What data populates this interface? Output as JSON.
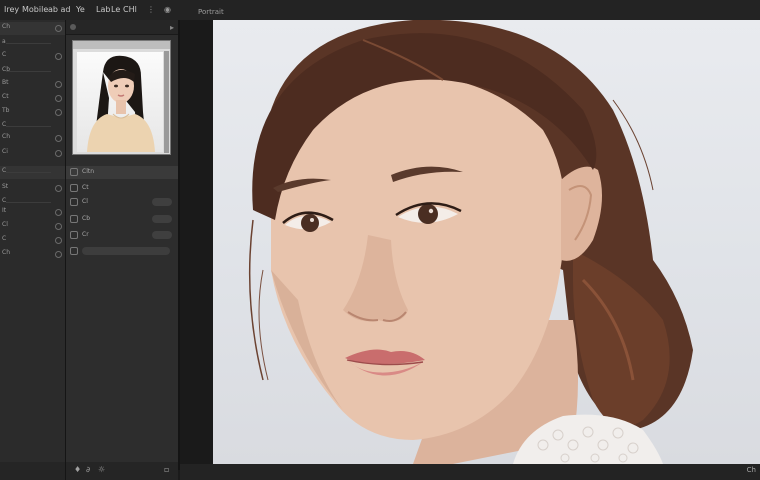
{
  "menubar": {
    "items": [
      "Irey",
      "Mobile",
      "ab ad",
      "Ye",
      "Lab",
      "Le",
      "CHl"
    ],
    "document_title": "Portrait"
  },
  "left_panel": {
    "rows": [
      "Ch",
      "a",
      "C",
      "Cb",
      "Bt",
      "Ct",
      "Tb",
      "C",
      "Ch",
      "Ci",
      "C",
      "St",
      "C",
      "It",
      "Cl",
      "C",
      "Ch"
    ]
  },
  "middle_panel": {
    "rows": [
      "Cltn",
      "Ct",
      "Cl",
      "Cb",
      "Cr",
      ""
    ]
  },
  "status": {
    "text": "Ch"
  },
  "colors": {
    "panel": "#2b2b2b",
    "canvas": "#1e1e1e",
    "photo_bg": "#e6e8ec"
  }
}
